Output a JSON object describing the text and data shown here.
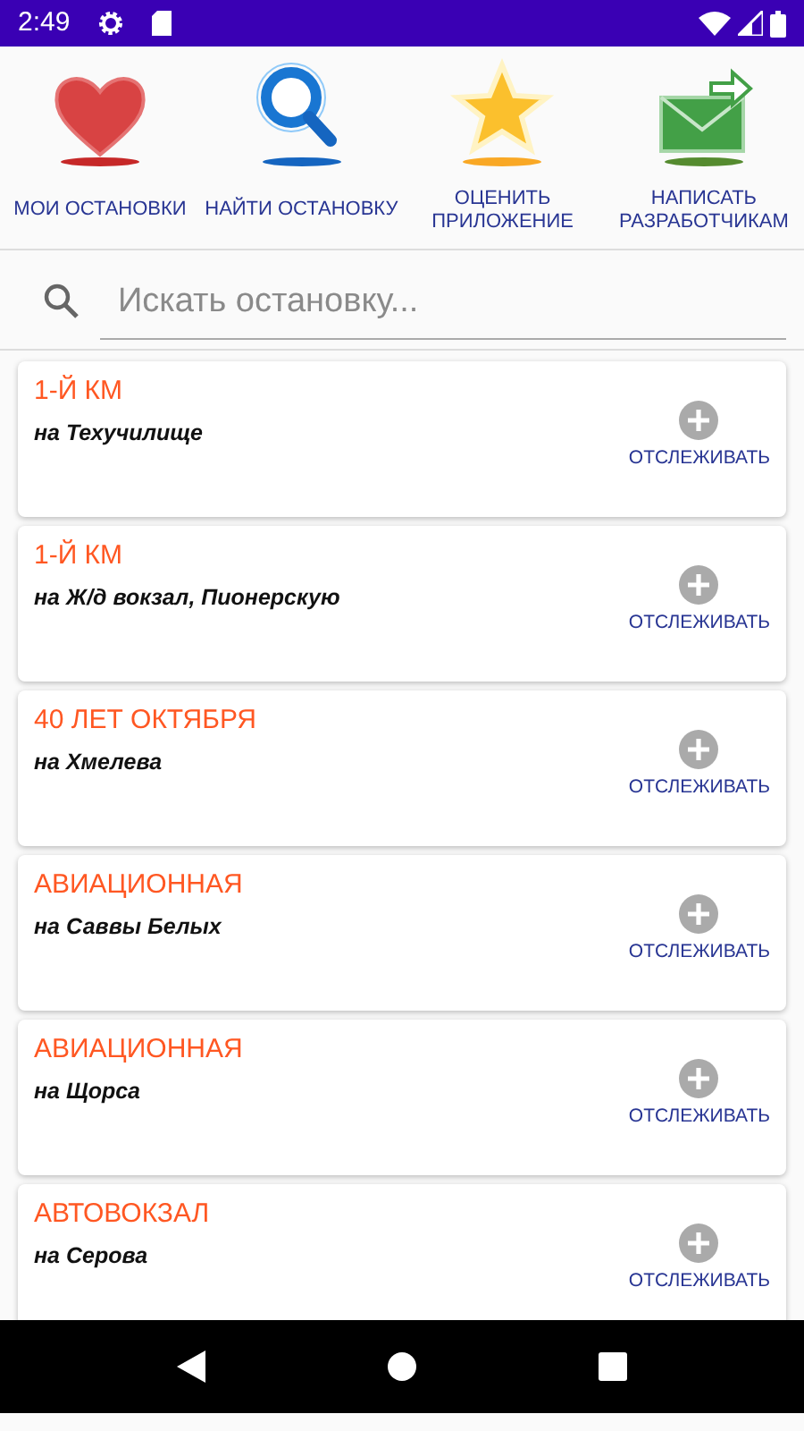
{
  "status_bar": {
    "time": "2:49"
  },
  "actions": [
    {
      "label": "МОИ ОСТАНОВКИ"
    },
    {
      "label": "НАЙТИ ОСТАНОВКУ"
    },
    {
      "label": "ОЦЕНИТЬ ПРИЛОЖЕНИЕ"
    },
    {
      "label": "НАПИСАТЬ РАЗРАБОТЧИКАМ"
    }
  ],
  "search": {
    "placeholder": "Искать остановку..."
  },
  "stops": [
    {
      "name": "1-Й КМ",
      "direction": "на Техучилище",
      "action": "ОТСЛЕЖИВАТЬ"
    },
    {
      "name": "1-Й КМ",
      "direction": "на Ж/д вокзал, Пионерскую",
      "action": "ОТСЛЕЖИВАТЬ"
    },
    {
      "name": "40 ЛЕТ ОКТЯБРЯ",
      "direction": "на Хмелева",
      "action": "ОТСЛЕЖИВАТЬ"
    },
    {
      "name": "АВИАЦИОННАЯ",
      "direction": "на Саввы Белых",
      "action": "ОТСЛЕЖИВАТЬ"
    },
    {
      "name": "АВИАЦИОННАЯ",
      "direction": "на Щорса",
      "action": "ОТСЛЕЖИВАТЬ"
    },
    {
      "name": "АВТОВОКЗАЛ",
      "direction": "на Серова",
      "action": "ОТСЛЕЖИВАТЬ"
    }
  ]
}
